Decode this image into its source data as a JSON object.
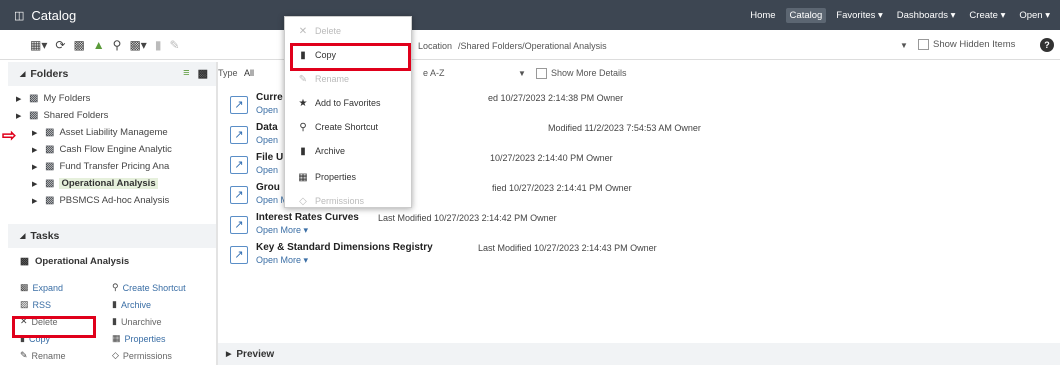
{
  "app": {
    "title": "Catalog"
  },
  "topnav": [
    "Home",
    "Catalog",
    "Favorites ▾",
    "Dashboards ▾",
    "Create ▾",
    "Open ▾"
  ],
  "toolbar": {
    "location_label": "Location",
    "location_path": "/Shared Folders/Operational Analysis",
    "show_hidden_label": "Show Hidden Items"
  },
  "folders": {
    "header": "Folders",
    "items": [
      {
        "label": "My Folders",
        "selected": false,
        "indent": 0
      },
      {
        "label": "Shared Folders",
        "selected": false,
        "indent": 0
      },
      {
        "label": "Asset Liability Manageme",
        "selected": false,
        "indent": 1
      },
      {
        "label": "Cash Flow Engine Analytic",
        "selected": false,
        "indent": 1
      },
      {
        "label": "Fund Transfer Pricing Ana",
        "selected": false,
        "indent": 1
      },
      {
        "label": "Operational Analysis",
        "selected": true,
        "indent": 1
      },
      {
        "label": "PBSMCS Ad-hoc Analysis",
        "selected": false,
        "indent": 1
      }
    ]
  },
  "tasks": {
    "header": "Tasks",
    "selected_folder": "Operational Analysis",
    "items": [
      {
        "label": "Expand",
        "disabled": false
      },
      {
        "label": "Create Shortcut",
        "disabled": false
      },
      {
        "label": "RSS",
        "disabled": false
      },
      {
        "label": "Archive",
        "disabled": false
      },
      {
        "label": "Delete",
        "disabled": true
      },
      {
        "label": "Unarchive",
        "disabled": true
      },
      {
        "label": "Copy",
        "disabled": false
      },
      {
        "label": "Properties",
        "disabled": false
      },
      {
        "label": "Rename",
        "disabled": true
      },
      {
        "label": "Permissions",
        "disabled": true
      }
    ]
  },
  "filter": {
    "type_label": "Type",
    "type_value": "All",
    "sort_value": "e A-Z",
    "show_more": "Show More Details"
  },
  "items": [
    {
      "name": "Curre",
      "meta": "ed 10/27/2023 2:14:38 PM   Owner",
      "links": "Open"
    },
    {
      "name": "Data",
      "meta": "Modified 11/2/2023 7:54:53 AM   Owner",
      "links": "Open"
    },
    {
      "name": "File U",
      "meta": "10/27/2023 2:14:40 PM   Owner",
      "links": "Open"
    },
    {
      "name": "Grou",
      "meta": "fied 10/27/2023 2:14:41 PM   Owner",
      "links": "Open  More ▾"
    },
    {
      "name": "Interest Rates Curves",
      "meta": "Last Modified 10/27/2023 2:14:42 PM   Owner",
      "links": "Open  More ▾"
    },
    {
      "name": "Key & Standard Dimensions Registry",
      "meta": "Last Modified 10/27/2023 2:14:43 PM   Owner",
      "links": "Open  More ▾"
    }
  ],
  "context_menu": [
    {
      "label": "Delete",
      "disabled": true
    },
    {
      "label": "Copy",
      "disabled": false
    },
    {
      "label": "Rename",
      "disabled": true
    },
    {
      "label": "Add to Favorites",
      "disabled": false
    },
    {
      "label": "Create Shortcut",
      "disabled": false
    },
    {
      "label": "Archive",
      "disabled": false
    },
    {
      "label": "Properties",
      "disabled": false
    },
    {
      "label": "Permissions",
      "disabled": true
    }
  ],
  "preview": {
    "label": "Preview"
  },
  "colors": {
    "accent_red": "#e0001b",
    "topbar": "#3d4652",
    "link": "#3a6ea5",
    "selected_bg": "#e6f0dc"
  }
}
